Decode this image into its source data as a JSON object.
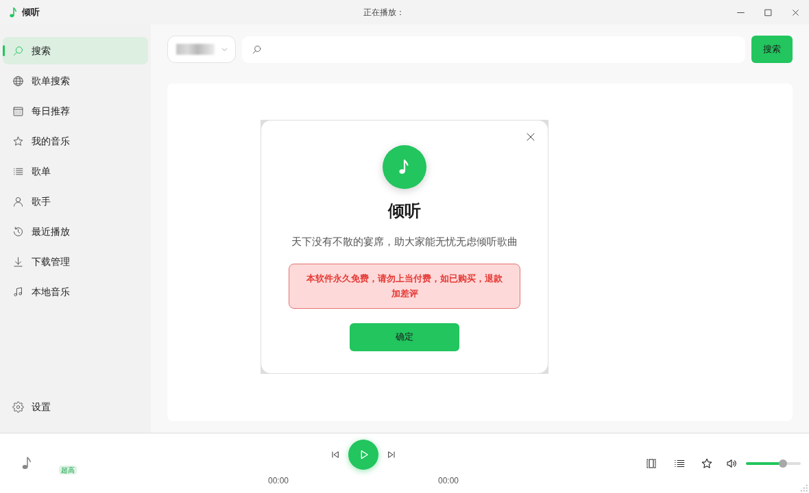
{
  "window": {
    "title": "倾听",
    "now_playing_label": "正在播放："
  },
  "sidebar": {
    "items": [
      {
        "label": "搜索",
        "selected": true
      },
      {
        "label": "歌单搜索",
        "selected": false
      },
      {
        "label": "每日推荐",
        "selected": false
      },
      {
        "label": "我的音乐",
        "selected": false
      },
      {
        "label": "歌单",
        "selected": false
      },
      {
        "label": "歌手",
        "selected": false
      },
      {
        "label": "最近播放",
        "selected": false
      },
      {
        "label": "下载管理",
        "selected": false
      },
      {
        "label": "本地音乐",
        "selected": false
      }
    ],
    "settings": {
      "label": "设置"
    }
  },
  "search_bar": {
    "search_button": "搜索"
  },
  "dialog": {
    "title": "倾听",
    "message": "天下没有不散的宴席，助大家能无忧无虑倾听歌曲",
    "warning": "本软件永久免费，请勿上当付费，如已购买，退款加差评",
    "confirm_button": "确定"
  },
  "player": {
    "quality_badge": "超高",
    "playing": false,
    "current_time": "00:00",
    "total_time": "00:00",
    "volume": {
      "level": 0.68
    }
  }
}
